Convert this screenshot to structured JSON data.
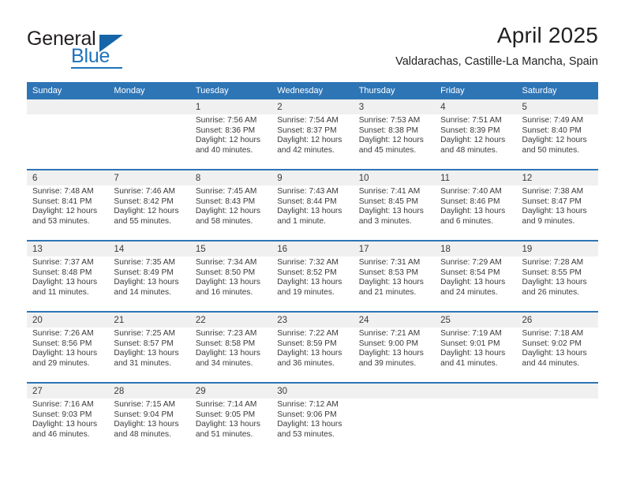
{
  "brand": {
    "name_part1": "General",
    "name_part2": "Blue",
    "triangle_icon": "blue-triangle-icon"
  },
  "header": {
    "title": "April 2025",
    "subtitle": "Valdarachas, Castille-La Mancha, Spain"
  },
  "colors": {
    "header_blue": "#2e75b6",
    "brand_blue": "#1e73be",
    "row_band_gray": "#f0f0f0",
    "text": "#3a3a3a"
  },
  "calendar": {
    "weekday_headers": [
      "Sunday",
      "Monday",
      "Tuesday",
      "Wednesday",
      "Thursday",
      "Friday",
      "Saturday"
    ],
    "weeks": [
      [
        {
          "day": "",
          "sunrise": "",
          "sunset": "",
          "daylight": ""
        },
        {
          "day": "",
          "sunrise": "",
          "sunset": "",
          "daylight": ""
        },
        {
          "day": "1",
          "sunrise": "Sunrise: 7:56 AM",
          "sunset": "Sunset: 8:36 PM",
          "daylight": "Daylight: 12 hours and 40 minutes."
        },
        {
          "day": "2",
          "sunrise": "Sunrise: 7:54 AM",
          "sunset": "Sunset: 8:37 PM",
          "daylight": "Daylight: 12 hours and 42 minutes."
        },
        {
          "day": "3",
          "sunrise": "Sunrise: 7:53 AM",
          "sunset": "Sunset: 8:38 PM",
          "daylight": "Daylight: 12 hours and 45 minutes."
        },
        {
          "day": "4",
          "sunrise": "Sunrise: 7:51 AM",
          "sunset": "Sunset: 8:39 PM",
          "daylight": "Daylight: 12 hours and 48 minutes."
        },
        {
          "day": "5",
          "sunrise": "Sunrise: 7:49 AM",
          "sunset": "Sunset: 8:40 PM",
          "daylight": "Daylight: 12 hours and 50 minutes."
        }
      ],
      [
        {
          "day": "6",
          "sunrise": "Sunrise: 7:48 AM",
          "sunset": "Sunset: 8:41 PM",
          "daylight": "Daylight: 12 hours and 53 minutes."
        },
        {
          "day": "7",
          "sunrise": "Sunrise: 7:46 AM",
          "sunset": "Sunset: 8:42 PM",
          "daylight": "Daylight: 12 hours and 55 minutes."
        },
        {
          "day": "8",
          "sunrise": "Sunrise: 7:45 AM",
          "sunset": "Sunset: 8:43 PM",
          "daylight": "Daylight: 12 hours and 58 minutes."
        },
        {
          "day": "9",
          "sunrise": "Sunrise: 7:43 AM",
          "sunset": "Sunset: 8:44 PM",
          "daylight": "Daylight: 13 hours and 1 minute."
        },
        {
          "day": "10",
          "sunrise": "Sunrise: 7:41 AM",
          "sunset": "Sunset: 8:45 PM",
          "daylight": "Daylight: 13 hours and 3 minutes."
        },
        {
          "day": "11",
          "sunrise": "Sunrise: 7:40 AM",
          "sunset": "Sunset: 8:46 PM",
          "daylight": "Daylight: 13 hours and 6 minutes."
        },
        {
          "day": "12",
          "sunrise": "Sunrise: 7:38 AM",
          "sunset": "Sunset: 8:47 PM",
          "daylight": "Daylight: 13 hours and 9 minutes."
        }
      ],
      [
        {
          "day": "13",
          "sunrise": "Sunrise: 7:37 AM",
          "sunset": "Sunset: 8:48 PM",
          "daylight": "Daylight: 13 hours and 11 minutes."
        },
        {
          "day": "14",
          "sunrise": "Sunrise: 7:35 AM",
          "sunset": "Sunset: 8:49 PM",
          "daylight": "Daylight: 13 hours and 14 minutes."
        },
        {
          "day": "15",
          "sunrise": "Sunrise: 7:34 AM",
          "sunset": "Sunset: 8:50 PM",
          "daylight": "Daylight: 13 hours and 16 minutes."
        },
        {
          "day": "16",
          "sunrise": "Sunrise: 7:32 AM",
          "sunset": "Sunset: 8:52 PM",
          "daylight": "Daylight: 13 hours and 19 minutes."
        },
        {
          "day": "17",
          "sunrise": "Sunrise: 7:31 AM",
          "sunset": "Sunset: 8:53 PM",
          "daylight": "Daylight: 13 hours and 21 minutes."
        },
        {
          "day": "18",
          "sunrise": "Sunrise: 7:29 AM",
          "sunset": "Sunset: 8:54 PM",
          "daylight": "Daylight: 13 hours and 24 minutes."
        },
        {
          "day": "19",
          "sunrise": "Sunrise: 7:28 AM",
          "sunset": "Sunset: 8:55 PM",
          "daylight": "Daylight: 13 hours and 26 minutes."
        }
      ],
      [
        {
          "day": "20",
          "sunrise": "Sunrise: 7:26 AM",
          "sunset": "Sunset: 8:56 PM",
          "daylight": "Daylight: 13 hours and 29 minutes."
        },
        {
          "day": "21",
          "sunrise": "Sunrise: 7:25 AM",
          "sunset": "Sunset: 8:57 PM",
          "daylight": "Daylight: 13 hours and 31 minutes."
        },
        {
          "day": "22",
          "sunrise": "Sunrise: 7:23 AM",
          "sunset": "Sunset: 8:58 PM",
          "daylight": "Daylight: 13 hours and 34 minutes."
        },
        {
          "day": "23",
          "sunrise": "Sunrise: 7:22 AM",
          "sunset": "Sunset: 8:59 PM",
          "daylight": "Daylight: 13 hours and 36 minutes."
        },
        {
          "day": "24",
          "sunrise": "Sunrise: 7:21 AM",
          "sunset": "Sunset: 9:00 PM",
          "daylight": "Daylight: 13 hours and 39 minutes."
        },
        {
          "day": "25",
          "sunrise": "Sunrise: 7:19 AM",
          "sunset": "Sunset: 9:01 PM",
          "daylight": "Daylight: 13 hours and 41 minutes."
        },
        {
          "day": "26",
          "sunrise": "Sunrise: 7:18 AM",
          "sunset": "Sunset: 9:02 PM",
          "daylight": "Daylight: 13 hours and 44 minutes."
        }
      ],
      [
        {
          "day": "27",
          "sunrise": "Sunrise: 7:16 AM",
          "sunset": "Sunset: 9:03 PM",
          "daylight": "Daylight: 13 hours and 46 minutes."
        },
        {
          "day": "28",
          "sunrise": "Sunrise: 7:15 AM",
          "sunset": "Sunset: 9:04 PM",
          "daylight": "Daylight: 13 hours and 48 minutes."
        },
        {
          "day": "29",
          "sunrise": "Sunrise: 7:14 AM",
          "sunset": "Sunset: 9:05 PM",
          "daylight": "Daylight: 13 hours and 51 minutes."
        },
        {
          "day": "30",
          "sunrise": "Sunrise: 7:12 AM",
          "sunset": "Sunset: 9:06 PM",
          "daylight": "Daylight: 13 hours and 53 minutes."
        },
        {
          "day": "",
          "sunrise": "",
          "sunset": "",
          "daylight": ""
        },
        {
          "day": "",
          "sunrise": "",
          "sunset": "",
          "daylight": ""
        },
        {
          "day": "",
          "sunrise": "",
          "sunset": "",
          "daylight": ""
        }
      ]
    ]
  }
}
